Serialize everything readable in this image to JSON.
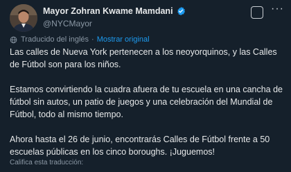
{
  "author": {
    "display_name": "Mayor Zohran Kwame Mamdani",
    "handle": "@NYCMayor"
  },
  "header": {
    "grok_icon": "grok-icon",
    "more_icon": "more-options-icon",
    "more_glyph": "···"
  },
  "translation": {
    "icon": "globe-icon",
    "label": "Traducido del inglés",
    "separator": "·",
    "show_original": "Mostrar original"
  },
  "post": {
    "paragraph_1": "Las calles de Nueva York pertenecen a los neoyorquinos, y las Calles de Fútbol son para los niños.",
    "paragraph_2": "Estamos convirtiendo la cuadra afuera de tu escuela en una cancha de fútbol sin autos, un patio de juegos y una celebración del Mundial de Fútbol, todo al mismo tiempo.",
    "paragraph_3": "Ahora hasta el 26 de junio, encontrarás Calles de Fútbol frente a 50 escuelas públicas en los cinco boroughs. ¡Juguemos!"
  },
  "footer": {
    "rate_translation": "Califica esta traducción:"
  },
  "colors": {
    "background": "#15202b",
    "primary_text": "#e7e9ea",
    "secondary_text": "#8b98a5",
    "accent": "#1d9bf0"
  }
}
